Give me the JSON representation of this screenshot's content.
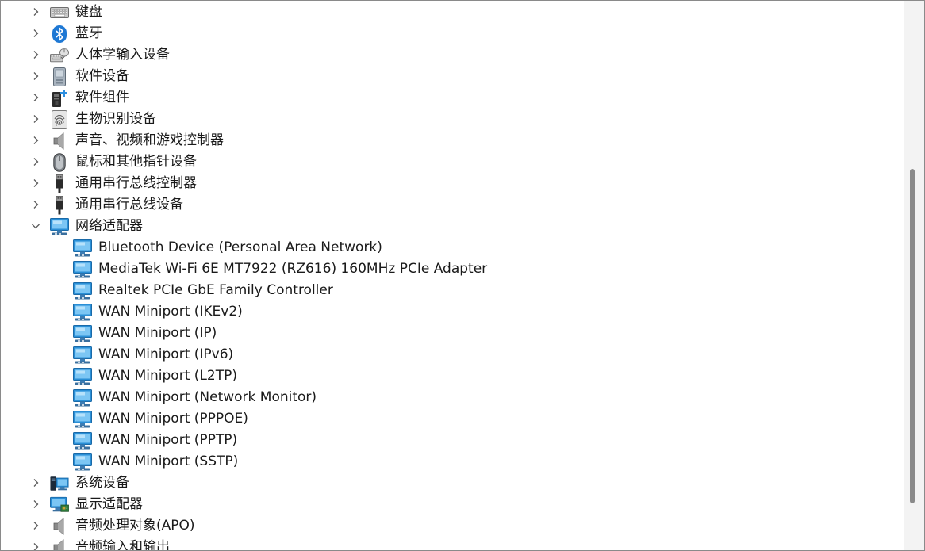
{
  "tree": {
    "items": [
      {
        "label": "键盘",
        "icon": "keyboard-icon",
        "level": 0,
        "expanded": false
      },
      {
        "label": "蓝牙",
        "icon": "bluetooth-icon",
        "level": 0,
        "expanded": false
      },
      {
        "label": "人体学输入设备",
        "icon": "hid-icon",
        "level": 0,
        "expanded": false
      },
      {
        "label": "软件设备",
        "icon": "software-device-icon",
        "level": 0,
        "expanded": false
      },
      {
        "label": "软件组件",
        "icon": "software-component-icon",
        "level": 0,
        "expanded": false
      },
      {
        "label": "生物识别设备",
        "icon": "fingerprint-icon",
        "level": 0,
        "expanded": false
      },
      {
        "label": "声音、视频和游戏控制器",
        "icon": "speaker-icon",
        "level": 0,
        "expanded": false
      },
      {
        "label": "鼠标和其他指针设备",
        "icon": "mouse-icon",
        "level": 0,
        "expanded": false
      },
      {
        "label": "通用串行总线控制器",
        "icon": "usb-icon",
        "level": 0,
        "expanded": false
      },
      {
        "label": "通用串行总线设备",
        "icon": "usb-icon",
        "level": 0,
        "expanded": false
      },
      {
        "label": "网络适配器",
        "icon": "network-adapter-icon",
        "level": 0,
        "expanded": true
      },
      {
        "label": "Bluetooth Device (Personal Area Network)",
        "icon": "network-adapter-icon",
        "level": 1
      },
      {
        "label": "MediaTek Wi-Fi 6E MT7922 (RZ616) 160MHz PCIe Adapter",
        "icon": "network-adapter-icon",
        "level": 1
      },
      {
        "label": "Realtek PCIe GbE Family Controller",
        "icon": "network-adapter-icon",
        "level": 1
      },
      {
        "label": "WAN Miniport (IKEv2)",
        "icon": "network-adapter-icon",
        "level": 1
      },
      {
        "label": "WAN Miniport (IP)",
        "icon": "network-adapter-icon",
        "level": 1
      },
      {
        "label": "WAN Miniport (IPv6)",
        "icon": "network-adapter-icon",
        "level": 1
      },
      {
        "label": "WAN Miniport (L2TP)",
        "icon": "network-adapter-icon",
        "level": 1
      },
      {
        "label": "WAN Miniport (Network Monitor)",
        "icon": "network-adapter-icon",
        "level": 1
      },
      {
        "label": "WAN Miniport (PPPOE)",
        "icon": "network-adapter-icon",
        "level": 1
      },
      {
        "label": "WAN Miniport (PPTP)",
        "icon": "network-adapter-icon",
        "level": 1
      },
      {
        "label": "WAN Miniport (SSTP)",
        "icon": "network-adapter-icon",
        "level": 1
      },
      {
        "label": "系统设备",
        "icon": "system-device-icon",
        "level": 0,
        "expanded": false
      },
      {
        "label": "显示适配器",
        "icon": "display-adapter-icon",
        "level": 0,
        "expanded": false
      },
      {
        "label": "音频处理对象(APO)",
        "icon": "speaker-icon",
        "level": 0,
        "expanded": false
      },
      {
        "label": "音频输入和输出",
        "icon": "speaker-icon",
        "level": 0,
        "expanded": false
      }
    ]
  },
  "colors": {
    "text": "#1a1a1a",
    "chevron": "#5a5a5a",
    "network_blue": "#2a8fd6",
    "bluetooth_blue": "#1e78d4",
    "scroll_thumb": "#8a8a8a"
  }
}
